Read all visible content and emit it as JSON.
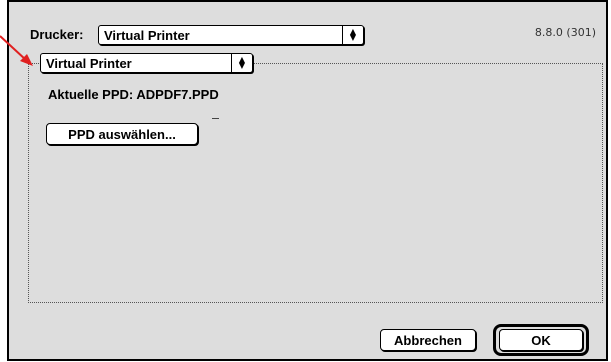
{
  "dialog": {
    "printer_label": "Drucker:",
    "printer_value": "Virtual Printer",
    "version": "8.8.0 (301)",
    "panel_value": "Virtual Printer",
    "ppd_label": "Aktuelle PPD: ADPDF7.PPD",
    "select_ppd_button": "PPD auswählen...",
    "cancel_button": "Abbrechen",
    "ok_button": "OK"
  },
  "colors": {
    "dialog_bg": "#dddddd",
    "annotation_arrow": "#e02020"
  },
  "icons": {
    "popup_arrows": "updown-arrows-icon",
    "annotation": "red-arrow-icon"
  }
}
